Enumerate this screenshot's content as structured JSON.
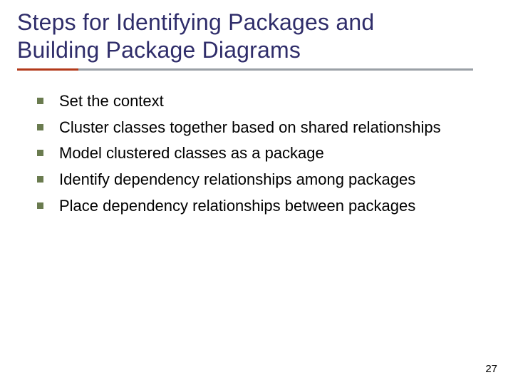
{
  "title_line1": "Steps for Identifying Packages and",
  "title_line2": "Building Package Diagrams",
  "items": {
    "0": "Set the context",
    "1": "Cluster classes together based on shared relationships",
    "2": "Model clustered classes as a package",
    "3": "Identify dependency relationships among packages",
    "4": "Place dependency relationships between packages"
  },
  "page_number": "27",
  "colors": {
    "title": "#2f2d6a",
    "bullet": "#6a7b4f",
    "underline_accent": "#b23a1a",
    "underline_gray": "#9aa0a6"
  }
}
